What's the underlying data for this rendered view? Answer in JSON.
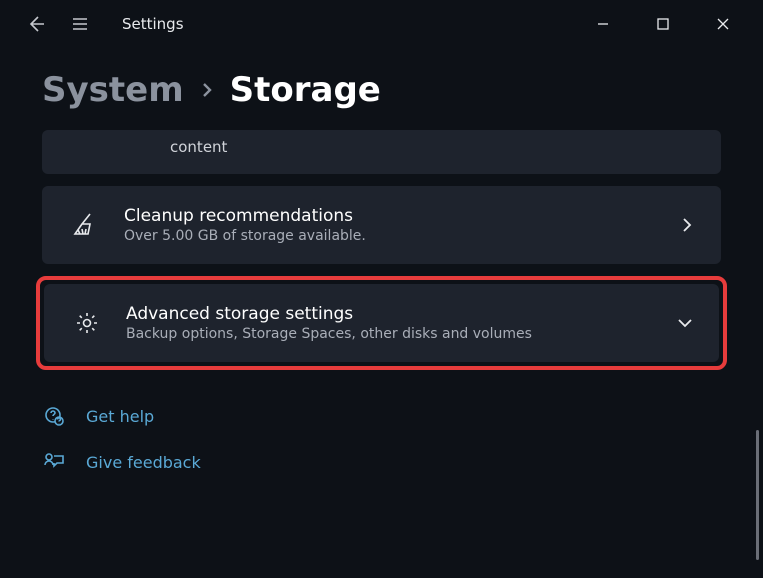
{
  "titlebar": {
    "title": "Settings"
  },
  "breadcrumb": {
    "parent": "System",
    "current": "Storage"
  },
  "panels": {
    "trunc": {
      "text": "content"
    },
    "cleanup": {
      "title": "Cleanup recommendations",
      "sub": "Over 5.00 GB of storage available."
    },
    "advanced": {
      "title": "Advanced storage settings",
      "sub": "Backup options, Storage Spaces, other disks and volumes"
    }
  },
  "footer": {
    "help": "Get help",
    "feedback": "Give feedback"
  }
}
